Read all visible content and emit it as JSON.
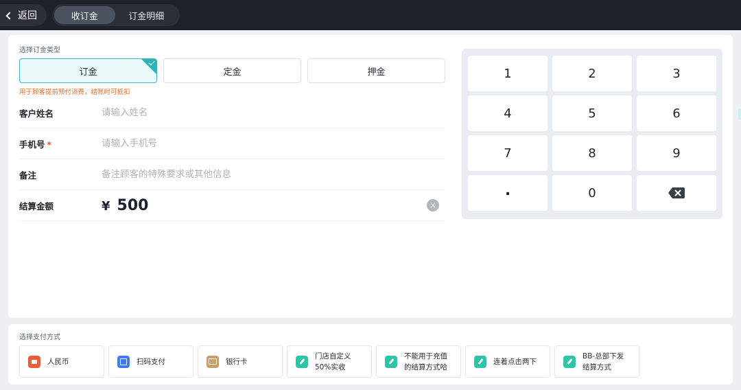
{
  "topbar": {
    "back_label": "返回",
    "tabs": [
      {
        "label": "收订金",
        "active": true
      },
      {
        "label": "订金明细",
        "active": false
      }
    ]
  },
  "order_type": {
    "section_label": "选择订金类型",
    "options": [
      {
        "label": "订金",
        "selected": true
      },
      {
        "label": "定金",
        "selected": false
      },
      {
        "label": "押金",
        "selected": false
      }
    ],
    "hint": "用于顾客提前预付消费，结账时可抵扣"
  },
  "form": {
    "name": {
      "label": "客户姓名",
      "placeholder": "请输入姓名"
    },
    "phone": {
      "label": "手机号",
      "required_mark": "*",
      "placeholder": "请输入手机号"
    },
    "note": {
      "label": "备注",
      "placeholder": "备注顾客的特殊要求或其他信息"
    },
    "amount": {
      "label": "结算金额",
      "currency": "¥",
      "value": "500",
      "clear_glyph": "×"
    }
  },
  "keypad": {
    "keys": [
      "1",
      "2",
      "3",
      "4",
      "5",
      "6",
      "7",
      "8",
      "9",
      ".",
      "0"
    ],
    "backspace_icon": "backspace-icon"
  },
  "payment": {
    "section_label": "选择支付方式",
    "methods": [
      {
        "line1": "人民币",
        "line2": "",
        "icon": "cash-icon",
        "color": "#f05a3c"
      },
      {
        "line1": "扫码支付",
        "line2": "",
        "icon": "scan-icon",
        "color": "#3e7bf0"
      },
      {
        "line1": "银行卡",
        "line2": "",
        "icon": "bank-card-icon",
        "color": "#c9a06b"
      },
      {
        "line1": "门店自定义",
        "line2": "50%实收",
        "icon": "edit-icon",
        "color": "#2ec4a6"
      },
      {
        "line1": "不能用于充值",
        "line2": "的结算方式哈",
        "icon": "edit-icon",
        "color": "#2ec4a6"
      },
      {
        "line1": "连着点击两下",
        "line2": "",
        "icon": "edit-icon",
        "color": "#2ec4a6"
      },
      {
        "line1": "BB-总部下发",
        "line2": "结算方式",
        "icon": "edit-icon",
        "color": "#2ec4a6"
      }
    ]
  },
  "colors": {
    "accent": "#2fb3b9",
    "hint": "#e86b2c",
    "topbar": "#1d2128"
  }
}
